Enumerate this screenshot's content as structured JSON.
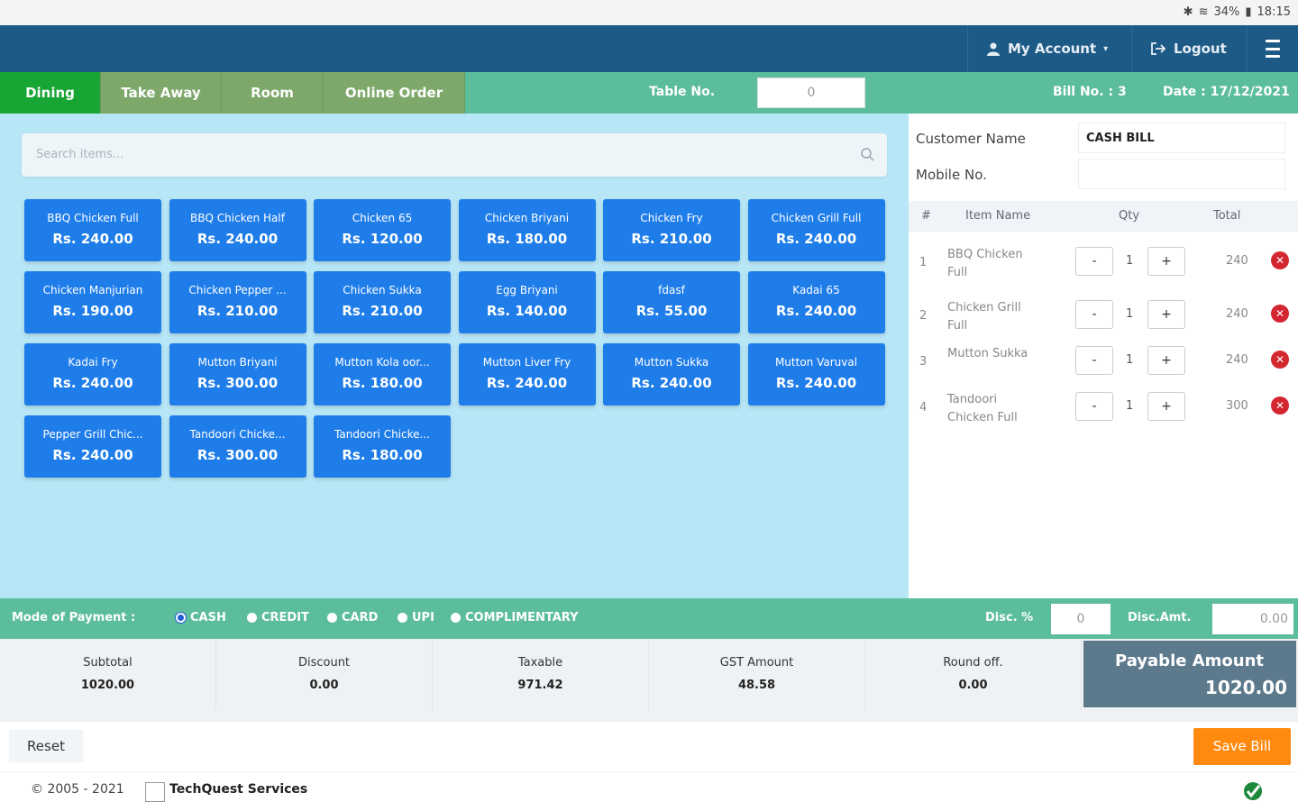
{
  "status_bar": {
    "battery": "34%",
    "time": "18:15"
  },
  "navbar": {
    "account_label": "My Account",
    "logout_label": "Logout"
  },
  "tabs": [
    "Dining",
    "Take Away",
    "Room",
    "Online Order"
  ],
  "active_tab": "Dining",
  "table_no": {
    "label": "Table No.",
    "value": "0"
  },
  "bill": {
    "bill_no": "Bill No. : 3",
    "date": "Date : 17/12/2021"
  },
  "search": {
    "placeholder": "Search items..."
  },
  "items": [
    {
      "name": "BBQ Chicken Full",
      "price": "Rs. 240.00"
    },
    {
      "name": "BBQ Chicken Half",
      "price": "Rs. 240.00"
    },
    {
      "name": "Chicken 65",
      "price": "Rs. 120.00"
    },
    {
      "name": "Chicken Briyani",
      "price": "Rs. 180.00"
    },
    {
      "name": "Chicken Fry",
      "price": "Rs. 210.00"
    },
    {
      "name": "Chicken Grill Full",
      "price": "Rs. 240.00"
    },
    {
      "name": "Chicken Manjurian",
      "price": "Rs. 190.00"
    },
    {
      "name": "Chicken Pepper ...",
      "price": "Rs. 210.00"
    },
    {
      "name": "Chicken Sukka",
      "price": "Rs. 210.00"
    },
    {
      "name": "Egg Briyani",
      "price": "Rs. 140.00"
    },
    {
      "name": "fdasf",
      "price": "Rs. 55.00"
    },
    {
      "name": "Kadai 65",
      "price": "Rs. 240.00"
    },
    {
      "name": "Kadai Fry",
      "price": "Rs. 240.00"
    },
    {
      "name": "Mutton Briyani",
      "price": "Rs. 300.00"
    },
    {
      "name": "Mutton Kola oor...",
      "price": "Rs. 180.00"
    },
    {
      "name": "Mutton Liver Fry",
      "price": "Rs. 240.00"
    },
    {
      "name": "Mutton Sukka",
      "price": "Rs. 240.00"
    },
    {
      "name": "Mutton Varuval",
      "price": "Rs. 240.00"
    },
    {
      "name": "Pepper Grill Chic...",
      "price": "Rs. 240.00"
    },
    {
      "name": "Tandoori Chicke...",
      "price": "Rs. 300.00"
    },
    {
      "name": "Tandoori Chicke...",
      "price": "Rs. 180.00"
    }
  ],
  "customer": {
    "name_label": "Customer Name",
    "name_value": "CASH BILL",
    "mobile_label": "Mobile No.",
    "mobile_value": ""
  },
  "order_table": {
    "headers": [
      "#",
      "Item Name",
      "Qty",
      "Total"
    ],
    "rows": [
      {
        "idx": "1",
        "name": "BBQ Chicken Full",
        "qty": "1",
        "total": "240"
      },
      {
        "idx": "2",
        "name": "Chicken Grill Full",
        "qty": "1",
        "total": "240"
      },
      {
        "idx": "3",
        "name": "Mutton Sukka",
        "qty": "1",
        "total": "240"
      },
      {
        "idx": "4",
        "name": "Tandoori Chicken Full",
        "qty": "1",
        "total": "300"
      }
    ]
  },
  "payment": {
    "label": "Mode of Payment :",
    "options": [
      "CASH",
      "CREDIT",
      "CARD",
      "UPI",
      "COMPLIMENTARY"
    ],
    "selected": "CASH",
    "disc_pct_label": "Disc. %",
    "disc_pct_value": "0",
    "disc_amt_label": "Disc.Amt.",
    "disc_amt_value": "0.00"
  },
  "totals": {
    "subtotal_label": "Subtotal",
    "subtotal": "1020.00",
    "discount_label": "Discount",
    "discount": "0.00",
    "taxable_label": "Taxable",
    "taxable": "971.42",
    "gst_label": "GST Amount",
    "gst": "48.58",
    "round_label": "Round off.",
    "round": "0.00",
    "payable_label": "Payable Amount",
    "payable": "1020.00"
  },
  "actions": {
    "reset": "Reset",
    "save": "Save Bill"
  },
  "footer": {
    "copyright": "© 2005 - 2021",
    "brand": "TechQuest Services"
  },
  "colors": {
    "navbar": "#1e5a86",
    "tab_bar": "#5bbd9b",
    "active_tab": "#17a534",
    "item_card": "#1f7de9",
    "save_button": "#ff8a0f",
    "payable_bg": "#5d7a8d"
  }
}
